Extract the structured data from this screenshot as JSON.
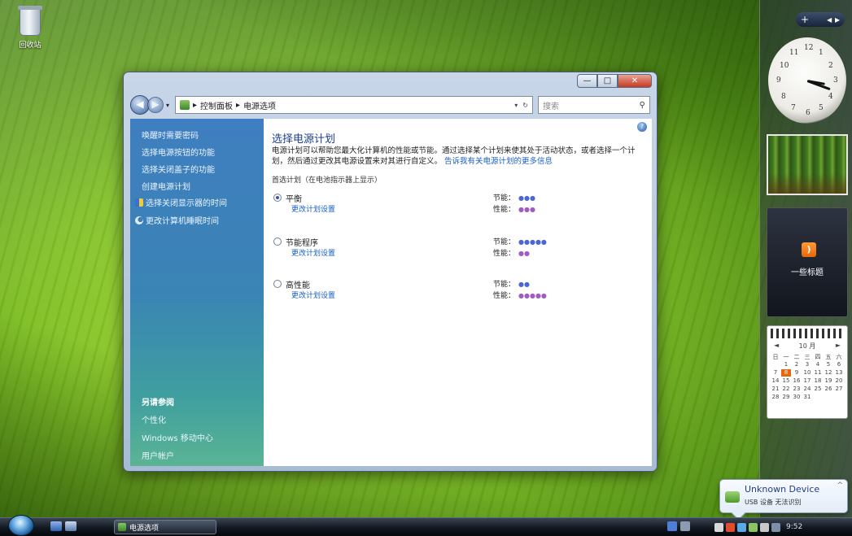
{
  "desktop": {
    "recycle_bin_label": "回收站"
  },
  "sidebar": {
    "top_control_label": "+",
    "clock_numbers": [
      "12",
      "1",
      "2",
      "3",
      "4",
      "5",
      "6",
      "7",
      "8",
      "9",
      "10",
      "11"
    ],
    "rss_label": "一些标题",
    "calendar": {
      "month_label": "10 月",
      "prev": "◄",
      "next": "►",
      "weekdays": [
        "日",
        "一",
        "二",
        "三",
        "四",
        "五",
        "六"
      ],
      "days": [
        "",
        "1",
        "2",
        "3",
        "4",
        "5",
        "6",
        "7",
        "8",
        "9",
        "10",
        "11",
        "12",
        "13",
        "14",
        "15",
        "16",
        "17",
        "18",
        "19",
        "20",
        "21",
        "22",
        "23",
        "24",
        "25",
        "26",
        "27",
        "28",
        "29",
        "30",
        "31"
      ],
      "today": "8"
    }
  },
  "window": {
    "controls": {
      "minimize": "—",
      "maximize": "□",
      "close": "✕"
    },
    "address": {
      "crumbs": [
        "控制面板",
        "电源选项"
      ],
      "search_placeholder": "搜索"
    },
    "left_tasks": [
      "唤醒时需要密码",
      "选择电源按钮的功能",
      "选择关闭盖子的功能",
      "创建电源计划",
      "选择关闭显示器的时间",
      "更改计算机睡眠时间"
    ],
    "see_also": {
      "heading": "另请参阅",
      "links": [
        "个性化",
        "Windows 移动中心",
        "用户帐户"
      ]
    },
    "main": {
      "help": "?",
      "title": "选择电源计划",
      "description": "电源计划可以帮助您最大化计算机的性能或节能。通过选择某个计划来使其处于活动状态，或者选择一个计划，然后通过更改其电源设置来对其进行自定义。",
      "description_link": "告诉我有关电源计划的更多信息",
      "section_label": "首选计划（在电池指示器上显示）",
      "plans": [
        {
          "name": "平衡",
          "change_link": "更改计划设置",
          "selected": true,
          "savings_label": "节能：",
          "savings": "●●●",
          "performance_label": "性能：",
          "performance": "●●●"
        },
        {
          "name": "节能程序",
          "change_link": "更改计划设置",
          "selected": false,
          "savings_label": "节能：",
          "savings": "●●●●●",
          "performance_label": "性能：",
          "performance": "●●"
        },
        {
          "name": "高性能",
          "change_link": "更改计划设置",
          "selected": false,
          "savings_label": "节能：",
          "savings": "●●",
          "performance_label": "性能：",
          "performance": "●●●●●"
        }
      ]
    }
  },
  "taskbar": {
    "task_button_label": "电源选项",
    "clock": "9:52"
  },
  "balloon": {
    "title": "Unknown Device",
    "text": "USB 设备 无法识别",
    "close": "^"
  }
}
